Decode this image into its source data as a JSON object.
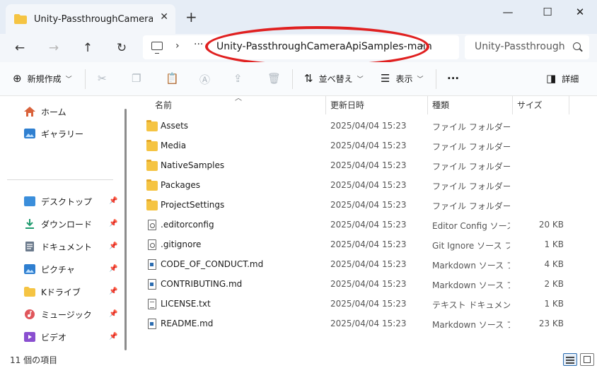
{
  "window": {
    "tab_title": "Unity-PassthroughCameraApiSamples-main",
    "tab_close": "✕",
    "new_tab": "+",
    "minimize": "—",
    "maximize": "☐",
    "close": "✕"
  },
  "address_bar": {
    "back": "←",
    "forward": "→",
    "up": "↑",
    "refresh": "↻",
    "overflow": "···",
    "path_segment": "Unity-PassthroughCameraApiSamples-main",
    "search_placeholder": "Unity-Passthrough"
  },
  "toolbar": {
    "new_label": "新規作成",
    "sort_label": "並べ替え",
    "view_label": "表示",
    "more_label": "···",
    "details_label": "詳細"
  },
  "sidebar": {
    "quick": [
      {
        "label": "ホーム",
        "icon": "home-icon"
      },
      {
        "label": "ギャラリー",
        "icon": "gallery-icon"
      }
    ],
    "pinned": [
      {
        "label": "デスクトップ",
        "icon": "desktop-icon",
        "color": "#3b8edb"
      },
      {
        "label": "ダウンロード",
        "icon": "download-icon",
        "color": "#1f9a6e"
      },
      {
        "label": "ドキュメント",
        "icon": "documents-icon",
        "color": "#6b7a8c"
      },
      {
        "label": "ピクチャ",
        "icon": "pictures-icon",
        "color": "#2f7fd0"
      },
      {
        "label": "Kドライブ",
        "icon": "folder-icon",
        "color": "#f5c443"
      },
      {
        "label": "ミュージック",
        "icon": "music-icon",
        "color": "#e0565b"
      },
      {
        "label": "ビデオ",
        "icon": "video-icon",
        "color": "#8a4fd0"
      }
    ]
  },
  "columns": {
    "name": "名前",
    "date": "更新日時",
    "type": "種類",
    "size": "サイズ"
  },
  "files": [
    {
      "name": "Assets",
      "date": "2025/04/04 15:23",
      "type": "ファイル フォルダー",
      "size": "",
      "icon": "folder"
    },
    {
      "name": "Media",
      "date": "2025/04/04 15:23",
      "type": "ファイル フォルダー",
      "size": "",
      "icon": "folder"
    },
    {
      "name": "NativeSamples",
      "date": "2025/04/04 15:23",
      "type": "ファイル フォルダー",
      "size": "",
      "icon": "folder"
    },
    {
      "name": "Packages",
      "date": "2025/04/04 15:23",
      "type": "ファイル フォルダー",
      "size": "",
      "icon": "folder"
    },
    {
      "name": "ProjectSettings",
      "date": "2025/04/04 15:23",
      "type": "ファイル フォルダー",
      "size": "",
      "icon": "folder"
    },
    {
      "name": ".editorconfig",
      "date": "2025/04/04 15:23",
      "type": "Editor Config ソース...",
      "size": "20 KB",
      "icon": "gear"
    },
    {
      "name": ".gitignore",
      "date": "2025/04/04 15:23",
      "type": "Git Ignore ソース フ...",
      "size": "1 KB",
      "icon": "gear"
    },
    {
      "name": "CODE_OF_CONDUCT.md",
      "date": "2025/04/04 15:23",
      "type": "Markdown ソース フ...",
      "size": "4 KB",
      "icon": "blue"
    },
    {
      "name": "CONTRIBUTING.md",
      "date": "2025/04/04 15:23",
      "type": "Markdown ソース フ...",
      "size": "2 KB",
      "icon": "blue"
    },
    {
      "name": "LICENSE.txt",
      "date": "2025/04/04 15:23",
      "type": "テキスト ドキュメント",
      "size": "1 KB",
      "icon": "txt"
    },
    {
      "name": "README.md",
      "date": "2025/04/04 15:23",
      "type": "Markdown ソース フ...",
      "size": "23 KB",
      "icon": "blue"
    }
  ],
  "status": {
    "item_count": "11 個の項目"
  },
  "colors": {
    "annotation": "#e02020",
    "folder": "#f5c443",
    "accent": "#2b6cb0"
  }
}
